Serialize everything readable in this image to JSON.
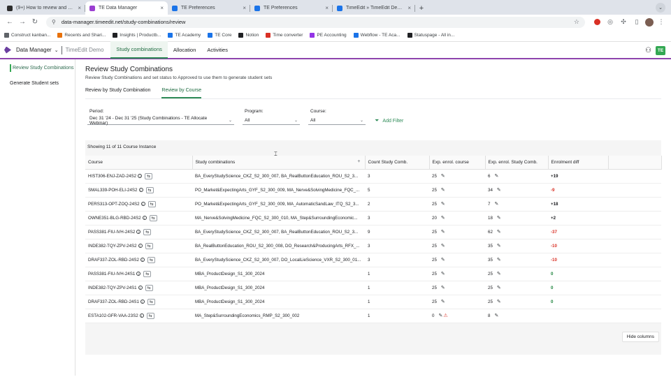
{
  "browser": {
    "tabs": [
      {
        "label": "(9+) How to review and acce",
        "color": "#2d2d2d",
        "active": false
      },
      {
        "label": "TE Data Manager",
        "color": "#9b3fd1",
        "active": true
      },
      {
        "label": "TE Preferences",
        "color": "#1a73e8",
        "active": false
      },
      {
        "label": "TE Preferences",
        "color": "#1a73e8",
        "active": false
      },
      {
        "label": "TimeEdit » TimeEdit Demo »",
        "color": "#1a73e8",
        "active": false
      }
    ],
    "url": "data-manager.timeedit.net/study-combinations/review",
    "bookmarks": [
      {
        "label": "Construct kanban...",
        "color": "#5f6368"
      },
      {
        "label": "Recents and Shari...",
        "color": "#e8710a"
      },
      {
        "label": "Insights | Productb...",
        "color": "#202124"
      },
      {
        "label": "TE Academy",
        "color": "#1a73e8"
      },
      {
        "label": "TE Core",
        "color": "#1a73e8"
      },
      {
        "label": "Notion",
        "color": "#202124"
      },
      {
        "label": "Time converter",
        "color": "#d93025"
      },
      {
        "label": "PE Accounting",
        "color": "#9334e6"
      },
      {
        "label": "Webflow - TE Aca...",
        "color": "#1a73e8"
      },
      {
        "label": "Statuspage - All in...",
        "color": "#202124"
      }
    ]
  },
  "app": {
    "name": "Data Manager",
    "environment": "TimeEdit Demo",
    "nav_tabs": [
      {
        "label": "Study combinations",
        "active": true
      },
      {
        "label": "Allocation",
        "active": false
      },
      {
        "label": "Activities",
        "active": false
      }
    ],
    "badge": "TE"
  },
  "sidebar": {
    "items": [
      {
        "label": "Review Study Combinations",
        "active": true
      },
      {
        "label": "Generate Student sets",
        "active": false
      }
    ]
  },
  "page": {
    "title": "Review Study Combinations",
    "subtitle": "Review Study Combinations and set status to Approved to use them to generate student sets",
    "subtabs": [
      {
        "label": "Review by Study Combination",
        "active": false
      },
      {
        "label": "Review by Course",
        "active": true
      }
    ]
  },
  "filters": {
    "period_label": "Period:",
    "period_value": "Dec 31 '24 - Dec 31 '25 (Study Combinations - TE Allocate Webinar)",
    "program_label": "Program:",
    "program_value": "All",
    "course_label": "Course:",
    "course_value": "All",
    "add_filter": "Add Filter"
  },
  "table": {
    "showing": "Showing 11 of 11 Course Instance",
    "columns": [
      "Course",
      "Study combinations",
      "Count Study Comb.",
      "Exp. enrol. course",
      "Exp. enrol. Study Comb.",
      "Enrolment diff"
    ],
    "rows": [
      {
        "course": "HIST306-ENJ-ZAD-24S2",
        "combos": "BA_EveryStudyScience_CKZ_S2_300_007, BA_RealButtonEducation_ROU_S2_3...",
        "count": "3",
        "exp_course": "25",
        "exp_combo": "6",
        "diff": "+19",
        "kind": "pos",
        "warn": false
      },
      {
        "course": "SMAL339-POH-ELI-24S2",
        "combos": "PO_Market&ExpectingArts_GYF_S2_300_009, MA_Nerve&SolvingMedicine_FQC_...",
        "count": "5",
        "exp_course": "25",
        "exp_combo": "34",
        "diff": "-9",
        "kind": "neg",
        "warn": false
      },
      {
        "course": "PERS313-OPT-ZOQ-24S2",
        "combos": "PO_Market&ExpectingArts_GYF_S2_300_009, MA_AutomaticSandLaw_ITQ_S2_3...",
        "count": "2",
        "exp_course": "25",
        "exp_combo": "7",
        "diff": "+18",
        "kind": "pos",
        "warn": false
      },
      {
        "course": "OWNE351-BLG-RBD-24S2",
        "combos": "MA_Nerve&SolvingMedicine_FQC_S2_300_010, MA_Step&SurroundingEconomic...",
        "count": "3",
        "exp_course": "20",
        "exp_combo": "18",
        "diff": "+2",
        "kind": "pos",
        "warn": false
      },
      {
        "course": "PASS381-FIU-IVH-24S2",
        "combos": "BA_EveryStudyScience_CKZ_S2_300_007, BA_RealButtonEducation_ROU_S2_3...",
        "count": "9",
        "exp_course": "25",
        "exp_combo": "62",
        "diff": "-37",
        "kind": "neg",
        "warn": false
      },
      {
        "course": "INDE382-TQY-ZPV-24S2",
        "combos": "BA_RealButtonEducation_ROU_S2_300_008, DO_Research&ProducingArts_RFX_...",
        "count": "3",
        "exp_course": "25",
        "exp_combo": "35",
        "diff": "-10",
        "kind": "neg",
        "warn": false
      },
      {
        "course": "DRAF337-ZOL-RBD-24S2",
        "combos": "BA_EveryStudyScience_CKZ_S2_300_007, DO_LocalLieScience_VXR_S2_300_01...",
        "count": "3",
        "exp_course": "25",
        "exp_combo": "35",
        "diff": "-10",
        "kind": "neg",
        "warn": false
      },
      {
        "course": "PASS381-FIU-IVH-24S1",
        "combos": "MBA_ProductDesign_S1_300_2024",
        "count": "1",
        "exp_course": "25",
        "exp_combo": "25",
        "diff": "0",
        "kind": "zero",
        "warn": false
      },
      {
        "course": "INDE382-TQY-ZPV-24S1",
        "combos": "MBA_ProductDesign_S1_300_2024",
        "count": "1",
        "exp_course": "25",
        "exp_combo": "25",
        "diff": "0",
        "kind": "zero",
        "warn": false
      },
      {
        "course": "DRAF337-ZOL-RBD-24S1",
        "combos": "MBA_ProductDesign_S1_300_2024",
        "count": "1",
        "exp_course": "25",
        "exp_combo": "25",
        "diff": "0",
        "kind": "zero",
        "warn": false
      },
      {
        "course": "ESTA102-GFR-VAA-23S2",
        "combos": "MA_Step&SurroundingEconomics_RMP_S2_300_002",
        "count": "1",
        "exp_course": "0",
        "exp_combo": "8",
        "diff": "",
        "kind": "none",
        "warn": true
      }
    ],
    "hide_columns": "Hide columns"
  }
}
